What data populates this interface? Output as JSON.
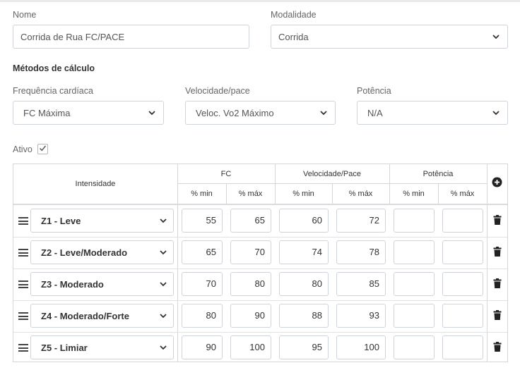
{
  "form": {
    "nome_label": "Nome",
    "nome_value": "Corrida de Rua FC/PACE",
    "modalidade_label": "Modalidade",
    "modalidade_value": "Corrida",
    "metodos_title": "Métodos de cálculo",
    "fc_label": "Frequência cardíaca",
    "fc_value": "FC Máxima",
    "vel_label": "Velocidade/pace",
    "vel_value": "Veloc. Vo2 Máximo",
    "pot_label": "Potência",
    "pot_value": "N/A",
    "ativo_label": "Ativo",
    "ativo_checked": true
  },
  "table": {
    "intensidade_header": "Intensidade",
    "fc_header": "FC",
    "vel_header": "Velocidade/Pace",
    "pot_header": "Potência",
    "min_header": "% min",
    "max_header": "% máx",
    "rows": [
      {
        "zone": "Z1 - Leve",
        "fc_min": "55",
        "fc_max": "65",
        "vel_min": "60",
        "vel_max": "72",
        "pot_min": "",
        "pot_max": ""
      },
      {
        "zone": "Z2 - Leve/Moderado",
        "fc_min": "65",
        "fc_max": "70",
        "vel_min": "74",
        "vel_max": "78",
        "pot_min": "",
        "pot_max": ""
      },
      {
        "zone": "Z3 - Moderado",
        "fc_min": "70",
        "fc_max": "80",
        "vel_min": "80",
        "vel_max": "85",
        "pot_min": "",
        "pot_max": ""
      },
      {
        "zone": "Z4 - Moderado/Forte",
        "fc_min": "80",
        "fc_max": "90",
        "vel_min": "88",
        "vel_max": "93",
        "pot_min": "",
        "pot_max": ""
      },
      {
        "zone": "Z5 - Limiar",
        "fc_min": "90",
        "fc_max": "100",
        "vel_min": "95",
        "vel_max": "100",
        "pot_min": "",
        "pot_max": ""
      }
    ]
  },
  "icons": {
    "chevron": "chevron-down-icon",
    "check": "check-icon",
    "add": "plus-circle-icon",
    "trash": "trash-icon",
    "drag": "drag-handle-icon"
  },
  "colors": {
    "border": "#cfd4da",
    "text": "#555555",
    "icon": "#222222"
  }
}
